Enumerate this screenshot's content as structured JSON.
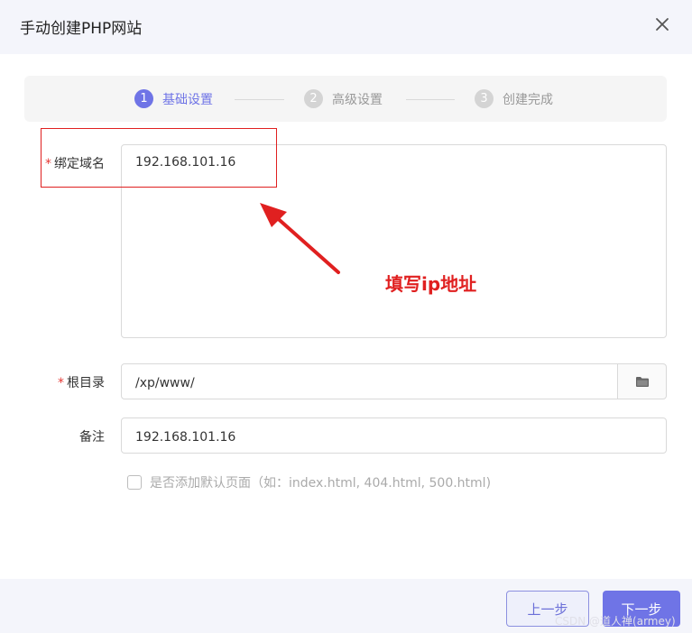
{
  "dialog": {
    "title": "手动创建PHP网站"
  },
  "steps": [
    {
      "num": "1",
      "label": "基础设置"
    },
    {
      "num": "2",
      "label": "高级设置"
    },
    {
      "num": "3",
      "label": "创建完成"
    }
  ],
  "form": {
    "required_mark": "*",
    "domain": {
      "label": "绑定域名",
      "value": "192.168.101.16"
    },
    "root": {
      "label": "根目录",
      "value": "/xp/www/"
    },
    "remark": {
      "label": "备注",
      "value": "192.168.101.16"
    },
    "default_page": {
      "label": "是否添加默认页面（如：index.html, 404.html, 500.html)"
    }
  },
  "annotation": {
    "text": "填写ip地址"
  },
  "footer": {
    "prev_label": "上一步",
    "next_label": "下一步"
  },
  "watermark": "CSDN @道人禅(armey)",
  "colors": {
    "accent": "#6f74e6",
    "annotation": "#e02020",
    "required": "#e53935"
  },
  "icons": {
    "close": "close-icon",
    "folder": "folder-icon"
  }
}
